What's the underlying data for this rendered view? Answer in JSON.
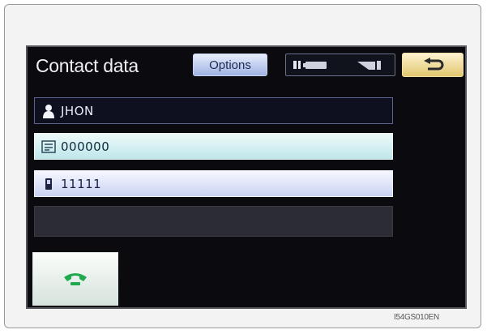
{
  "screen": {
    "title": "Contact data",
    "options_label": "Options",
    "back_icon": "return-arrow-icon",
    "status": {
      "bluetooth_icon": "bluetooth-icon",
      "battery_icon": "battery-icon",
      "signal_icon": "signal-strength-icon"
    }
  },
  "contact": {
    "name": "JHON",
    "name_icon": "person-icon",
    "phone": "000000",
    "phone_icon": "phone-book-icon",
    "mobile": "11111",
    "mobile_icon": "mobile-phone-icon"
  },
  "call_icon": "call-handset-icon",
  "colors": {
    "call_green": "#1faa4f",
    "options_blue": "#9fb3e3",
    "back_gold": "#e2c76f"
  },
  "image_code": "I54GS010EN"
}
